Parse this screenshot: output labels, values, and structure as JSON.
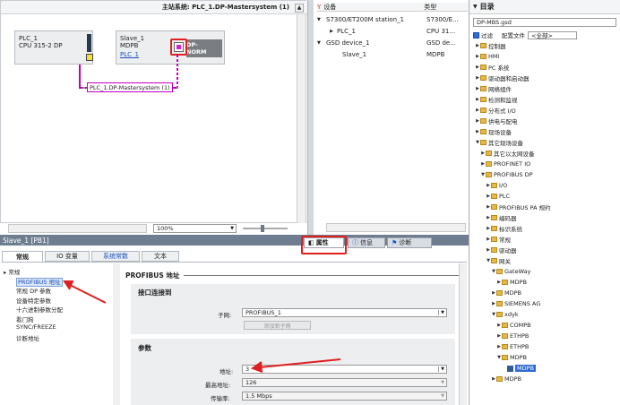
{
  "network": {
    "header": "主站系统: PLC_1.DP-Mastersystem (1)",
    "plc": {
      "name": "PLC_1",
      "type": "CPU 315-2 DP"
    },
    "slave": {
      "name": "Slave_1",
      "type": "MDPB",
      "link": "PLC_1",
      "module_label": "DP-NORM"
    },
    "bus_label": "PLC_1.DP-Mastersystem (1)",
    "zoom": "100%"
  },
  "table": {
    "columns": [
      "设备",
      "类型"
    ],
    "rows": [
      {
        "name": "S7300/ET200M station_1",
        "type": "S7300/E..."
      },
      {
        "name": "PLC_1",
        "type": "CPU 31..."
      },
      {
        "name": "GSD device_1",
        "type": "GSD de..."
      },
      {
        "name": "Slave_1",
        "type": "MDPB"
      }
    ]
  },
  "catalog": {
    "title": "目录",
    "search_value": "DP-MBS.gsd",
    "filter_label": "过滤",
    "config_label": "配置文件",
    "config_value": "<全部>",
    "items": [
      {
        "label": "控制器",
        "level": 0,
        "state": "closed",
        "icon": "folder"
      },
      {
        "label": "HMI",
        "level": 0,
        "state": "closed",
        "icon": "folder"
      },
      {
        "label": "PC 系统",
        "level": 0,
        "state": "closed",
        "icon": "folder"
      },
      {
        "label": "驱动器和启动器",
        "level": 0,
        "state": "closed",
        "icon": "folder"
      },
      {
        "label": "网络组件",
        "level": 0,
        "state": "closed",
        "icon": "folder"
      },
      {
        "label": "检测和监视",
        "level": 0,
        "state": "closed",
        "icon": "folder"
      },
      {
        "label": "分布式 I/O",
        "level": 0,
        "state": "closed",
        "icon": "folder"
      },
      {
        "label": "供电与配电",
        "level": 0,
        "state": "closed",
        "icon": "folder"
      },
      {
        "label": "现场设备",
        "level": 0,
        "state": "closed",
        "icon": "folder"
      },
      {
        "label": "其它现场设备",
        "level": 0,
        "state": "open",
        "icon": "folder"
      },
      {
        "label": "其它以太网设备",
        "level": 1,
        "state": "closed",
        "icon": "folder"
      },
      {
        "label": "PROFINET IO",
        "level": 1,
        "state": "closed",
        "icon": "folder"
      },
      {
        "label": "PROFIBUS DP",
        "level": 1,
        "state": "open",
        "icon": "folder"
      },
      {
        "label": "I/O",
        "level": 2,
        "state": "closed",
        "icon": "folder"
      },
      {
        "label": "PLC",
        "level": 2,
        "state": "closed",
        "icon": "folder"
      },
      {
        "label": "PROFIBUS PA 规约",
        "level": 2,
        "state": "closed",
        "icon": "folder"
      },
      {
        "label": "编码器",
        "level": 2,
        "state": "closed",
        "icon": "folder"
      },
      {
        "label": "标识系统",
        "level": 2,
        "state": "closed",
        "icon": "folder"
      },
      {
        "label": "常规",
        "level": 2,
        "state": "closed",
        "icon": "folder"
      },
      {
        "label": "驱动器",
        "level": 2,
        "state": "closed",
        "icon": "folder"
      },
      {
        "label": "网关",
        "level": 2,
        "state": "open",
        "icon": "folder"
      },
      {
        "label": "GateWay",
        "level": 3,
        "state": "open",
        "icon": "folder"
      },
      {
        "label": "MDPB",
        "level": 4,
        "state": "closed",
        "icon": "folder"
      },
      {
        "label": "MDPB",
        "level": 3,
        "state": "closed",
        "icon": "folder"
      },
      {
        "label": "SIEMENS AG",
        "level": 3,
        "state": "closed",
        "icon": "folder"
      },
      {
        "label": "xdyk",
        "level": 3,
        "state": "open",
        "icon": "folder"
      },
      {
        "label": "COMPB",
        "level": 4,
        "state": "closed",
        "icon": "folder"
      },
      {
        "label": "ETHPB",
        "level": 4,
        "state": "closed",
        "icon": "folder"
      },
      {
        "label": "ETHPB",
        "level": 4,
        "state": "closed",
        "icon": "folder"
      },
      {
        "label": "MDPB",
        "level": 4,
        "state": "open",
        "icon": "folder"
      },
      {
        "label": "MDPB",
        "level": 5,
        "state": "none",
        "icon": "device"
      },
      {
        "label": "MDPB",
        "level": 3,
        "state": "closed",
        "icon": "folder"
      }
    ]
  },
  "properties": {
    "title": "Slave_1 [PB1]",
    "tabs": [
      "属性",
      "信息",
      "诊断"
    ],
    "subtabs": [
      "常规",
      "IO 变量",
      "系统常数",
      "文本"
    ],
    "nav": [
      {
        "label": "常规",
        "active": false
      },
      {
        "label": "PROFIBUS 地址",
        "active": true
      },
      {
        "label": "常规 DP 参数",
        "active": false
      },
      {
        "label": "设备特定参数",
        "active": false
      },
      {
        "label": "十六进制参数分配",
        "active": false
      },
      {
        "label": "看门狗",
        "active": false
      },
      {
        "label": "SYNC/FREEZE",
        "active": false
      },
      {
        "label": "诊断地址",
        "active": false
      }
    ],
    "section_title": "PROFIBUS 地址",
    "interface_title": "接口连接到",
    "subnet_label": "子网:",
    "subnet_value": "PROFIBUS_1",
    "add_subnet": "添加新子网",
    "params_title": "参数",
    "address_label": "地址:",
    "address_value": "3",
    "max_address_label": "最高地址:",
    "max_address_value": "126",
    "baud_label": "传输率:",
    "baud_value": "1.5 Mbps"
  },
  "colors": {
    "highlight": "#e02020",
    "accent": "#1a4fbf",
    "bus": "#c000c0"
  }
}
